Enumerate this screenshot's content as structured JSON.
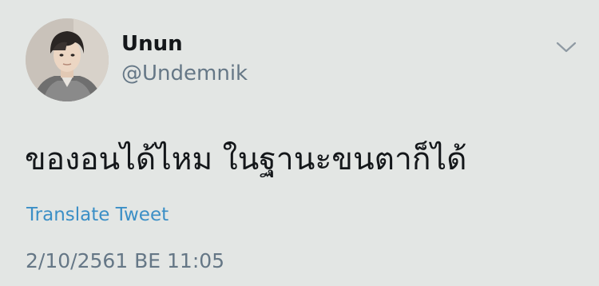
{
  "user": {
    "display_name": "Unun",
    "handle": "@Undemnik"
  },
  "tweet": {
    "text": "ของอนได้ไหม ในฐานะขนตาก็ได้",
    "translate_label": "Translate Tweet",
    "timestamp": "2/10/2561 BE 11:05"
  },
  "icons": {
    "menu": "chevron-down-icon",
    "avatar": "profile-photo"
  },
  "colors": {
    "background": "#e3e6e4",
    "link": "#3b8fc6",
    "secondary_text": "#657786",
    "primary_text": "#14171a"
  }
}
